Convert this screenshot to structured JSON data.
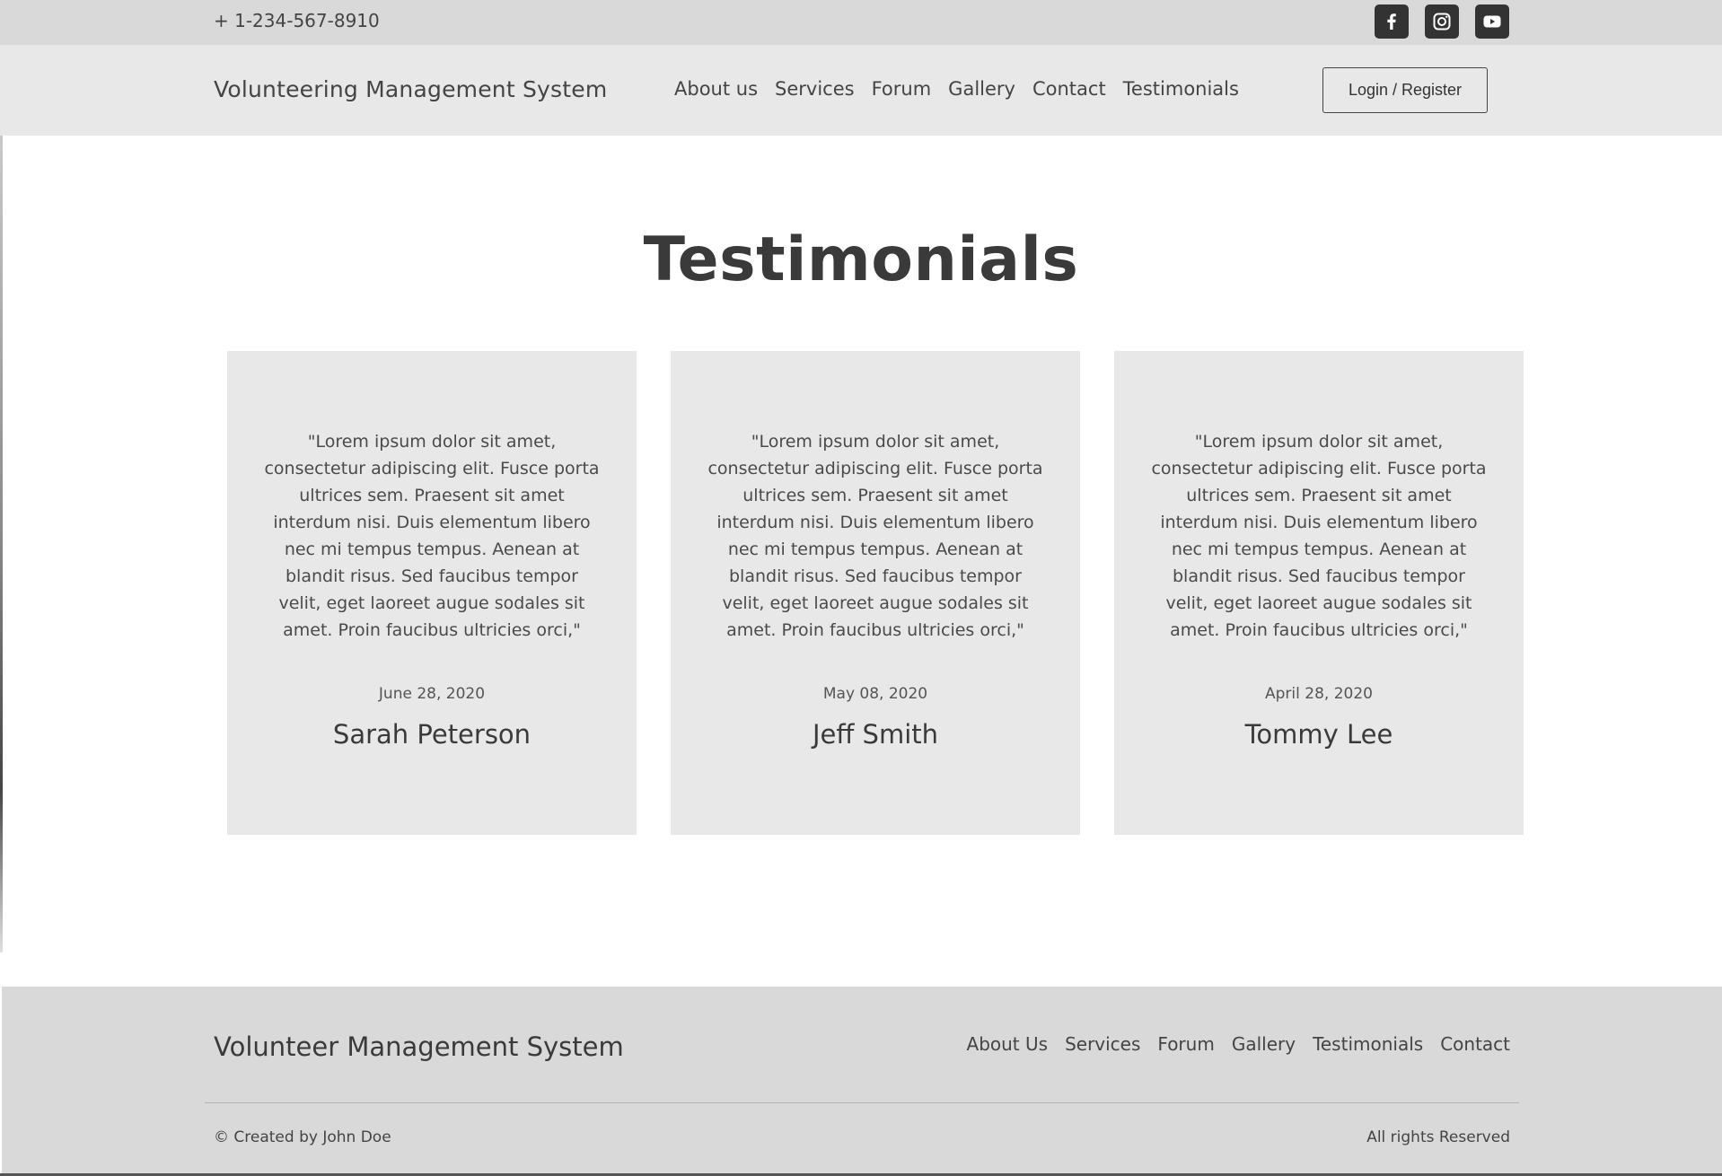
{
  "topbar": {
    "phone": "+ 1-234-567-8910",
    "socials": [
      {
        "icon": "facebook-icon"
      },
      {
        "icon": "instagram-icon"
      },
      {
        "icon": "youtube-icon"
      }
    ]
  },
  "header": {
    "brand": "Volunteering Management System",
    "nav": [
      "About us",
      "Services",
      "Forum",
      "Gallery",
      "Contact",
      "Testimonials"
    ],
    "login_label": "Login / Register"
  },
  "main": {
    "title": "Testimonials",
    "testimonials": [
      {
        "quote": "\"Lorem ipsum dolor sit amet, consectetur adipiscing elit. Fusce porta ultrices sem. Praesent sit amet interdum nisi. Duis elementum libero nec mi tempus tempus. Aenean at blandit risus. Sed faucibus tempor velit, eget laoreet augue sodales sit amet. Proin faucibus ultricies orci,\"",
        "date": "June 28, 2020",
        "name": "Sarah Peterson"
      },
      {
        "quote": "\"Lorem ipsum dolor sit amet, consectetur adipiscing elit. Fusce porta ultrices sem. Praesent sit amet interdum nisi. Duis elementum libero nec mi tempus tempus. Aenean at blandit risus. Sed faucibus tempor velit, eget laoreet augue sodales sit amet. Proin faucibus ultricies orci,\"",
        "date": "May 08, 2020",
        "name": "Jeff Smith"
      },
      {
        "quote": "\"Lorem ipsum dolor sit amet, consectetur adipiscing elit. Fusce porta ultrices sem. Praesent sit amet interdum nisi. Duis elementum libero nec mi tempus tempus. Aenean at blandit risus. Sed faucibus tempor velit, eget laoreet augue sodales sit amet. Proin faucibus ultricies orci,\"",
        "date": "April 28, 2020",
        "name": "Tommy Lee"
      }
    ]
  },
  "footer": {
    "brand": "Volunteer Management System",
    "nav": [
      "About Us",
      "Services",
      "Forum",
      "Gallery",
      "Testimonials",
      "Contact"
    ],
    "copyright": "© Created by John Doe",
    "rights": "All rights Reserved"
  },
  "colors": {
    "topbar_bg": "#d9d9d9",
    "navbar_bg": "#e8e8e8",
    "card_bg": "#e8e8e8",
    "footer_bg": "#d9d9d9",
    "text": "#444444",
    "social_bg": "#333333"
  }
}
